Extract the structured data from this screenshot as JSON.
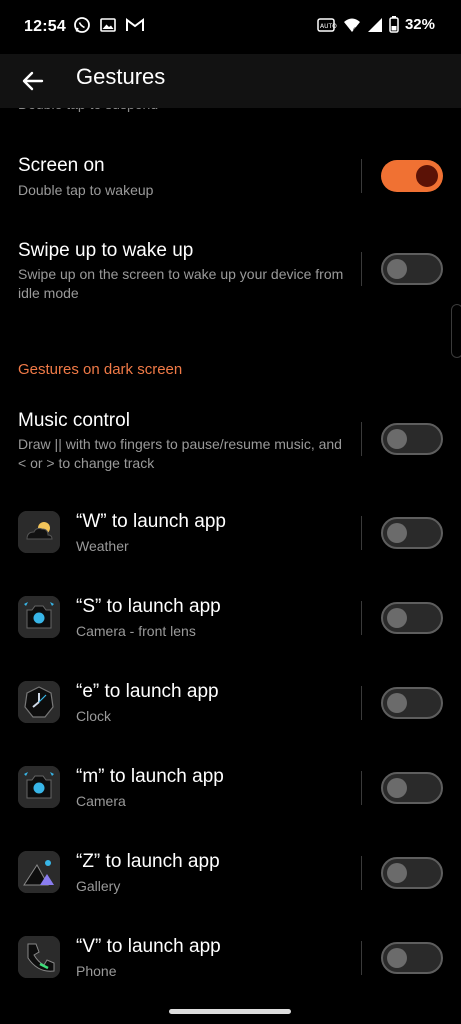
{
  "status_bar": {
    "time": "12:54",
    "battery": "32%",
    "icons": [
      "whatsapp-icon",
      "gallery-icon",
      "gmail-icon",
      "auto-data-icon",
      "wifi-icon",
      "signal-icon",
      "battery-icon"
    ]
  },
  "app_bar": {
    "title": "Gestures"
  },
  "clipped_subtitle": "Double tap to suspend",
  "settings": [
    {
      "title": "Screen on",
      "subtitle": "Double tap to wakeup",
      "enabled": true
    },
    {
      "title": "Swipe up to wake up",
      "subtitle": "Swipe up on the screen to wake up your device from idle mode",
      "enabled": false
    }
  ],
  "section_header": "Gestures on dark screen",
  "music_control": {
    "title": "Music control",
    "subtitle": "Draw || with two fingers to pause/resume music, and < or > to change track",
    "enabled": false
  },
  "launch_gestures": [
    {
      "title": "“W” to launch app",
      "app": "Weather",
      "icon": "weather-app-icon",
      "enabled": false
    },
    {
      "title": "“S” to launch app",
      "app": "Camera - front lens",
      "icon": "camera-app-icon",
      "enabled": false
    },
    {
      "title": "“e” to launch app",
      "app": "Clock",
      "icon": "clock-app-icon",
      "enabled": false
    },
    {
      "title": "“m” to launch app",
      "app": "Camera",
      "icon": "camera-app-icon",
      "enabled": false
    },
    {
      "title": "“Z” to launch app",
      "app": "Gallery",
      "icon": "gallery-app-icon",
      "enabled": false
    },
    {
      "title": "“V” to launch app",
      "app": "Phone",
      "icon": "phone-app-icon",
      "enabled": false
    }
  ],
  "colors": {
    "accent": "#f07133",
    "toggle_knob_on": "#5b1206",
    "section": "#f07a47"
  }
}
